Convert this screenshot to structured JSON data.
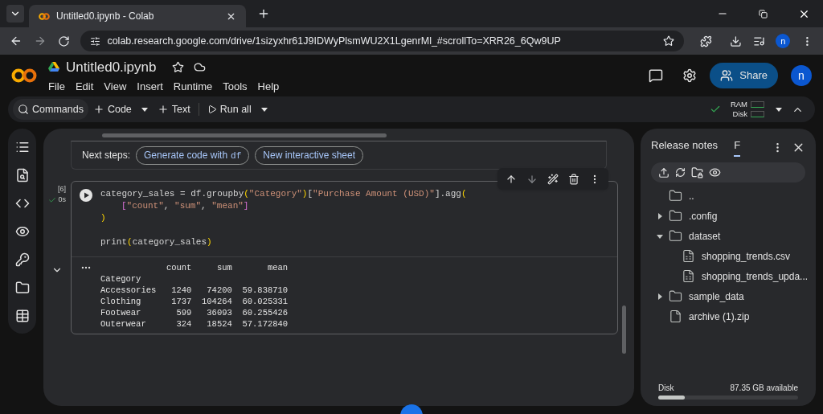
{
  "browser": {
    "tab_title": "Untitled0.ipynb - Colab",
    "url": "colab.research.google.com/drive/1sizyxhr61J9IDWyPlsmWU2X1LgenrMl_#scrollTo=XRR26_6Qw9UP",
    "profile": "n"
  },
  "notebook": {
    "title": "Untitled0.ipynb",
    "menu": [
      "File",
      "Edit",
      "View",
      "Insert",
      "Runtime",
      "Tools",
      "Help"
    ],
    "share": "Share",
    "avatar": "n"
  },
  "toolbar": {
    "commands": "Commands",
    "code": "Code",
    "text": "Text",
    "run_all": "Run all",
    "ram": "RAM",
    "disk": "Disk"
  },
  "next_steps": {
    "label": "Next steps:",
    "buttons": [
      {
        "label": "Generate code with",
        "code": "df"
      },
      {
        "label": "New interactive sheet"
      }
    ]
  },
  "cell": {
    "count": "[6]",
    "time": "0s",
    "code": [
      {
        "indent": false,
        "gap_before": false,
        "tokens": [
          {
            "t": "category_sales = df.groupby",
            "kind": "plain"
          },
          {
            "t": "(",
            "kind": "paren"
          },
          {
            "t": "\"Category\"",
            "kind": "string"
          },
          {
            "t": ")",
            "kind": "paren"
          },
          {
            "t": "[",
            "kind": "plain"
          },
          {
            "t": "\"Purchase Amount (USD)\"",
            "kind": "string"
          },
          {
            "t": "].agg",
            "kind": "plain"
          },
          {
            "t": "(",
            "kind": "paren"
          }
        ]
      },
      {
        "indent": true,
        "gap_before": false,
        "tokens": [
          {
            "t": "[",
            "kind": "bracket"
          },
          {
            "t": "\"count\"",
            "kind": "string"
          },
          {
            "t": ", ",
            "kind": "plain"
          },
          {
            "t": "\"sum\"",
            "kind": "string"
          },
          {
            "t": ", ",
            "kind": "plain"
          },
          {
            "t": "\"mean\"",
            "kind": "string"
          },
          {
            "t": "]",
            "kind": "bracket"
          }
        ]
      },
      {
        "indent": false,
        "gap_before": false,
        "tokens": [
          {
            "t": ")",
            "kind": "paren"
          }
        ]
      },
      {
        "indent": false,
        "gap_before": true,
        "tokens": [
          {
            "t": "print",
            "kind": "plain"
          },
          {
            "t": "(",
            "kind": "paren"
          },
          {
            "t": "category_sales",
            "kind": "plain"
          },
          {
            "t": ")",
            "kind": "paren"
          }
        ]
      }
    ],
    "output": [
      "             count     sum       mean",
      "Category",
      "Accessories   1240   74200  59.838710",
      "Clothing      1737  104264  60.025331",
      "Footwear       599   36093  60.255426",
      "Outerwear      324   18524  57.172840"
    ]
  },
  "side_panel": {
    "tabs": [
      {
        "label": "Release notes",
        "selected": false
      },
      {
        "label": "F",
        "selected": true
      }
    ],
    "files": [
      {
        "name": "..",
        "kind": "folder"
      },
      {
        "name": ".config",
        "kind": "folder",
        "expanded": false
      },
      {
        "name": "dataset",
        "kind": "folder",
        "expanded": true,
        "children": [
          {
            "name": "shopping_trends.csv",
            "kind": "csv"
          },
          {
            "name": "shopping_trends_upda...",
            "kind": "csv"
          }
        ]
      },
      {
        "name": "sample_data",
        "kind": "folder",
        "expanded": false
      },
      {
        "name": "archive (1).zip",
        "kind": "file"
      }
    ],
    "disk": {
      "label": "Disk",
      "reading": "87.35 GB available",
      "level": 0.19
    }
  }
}
